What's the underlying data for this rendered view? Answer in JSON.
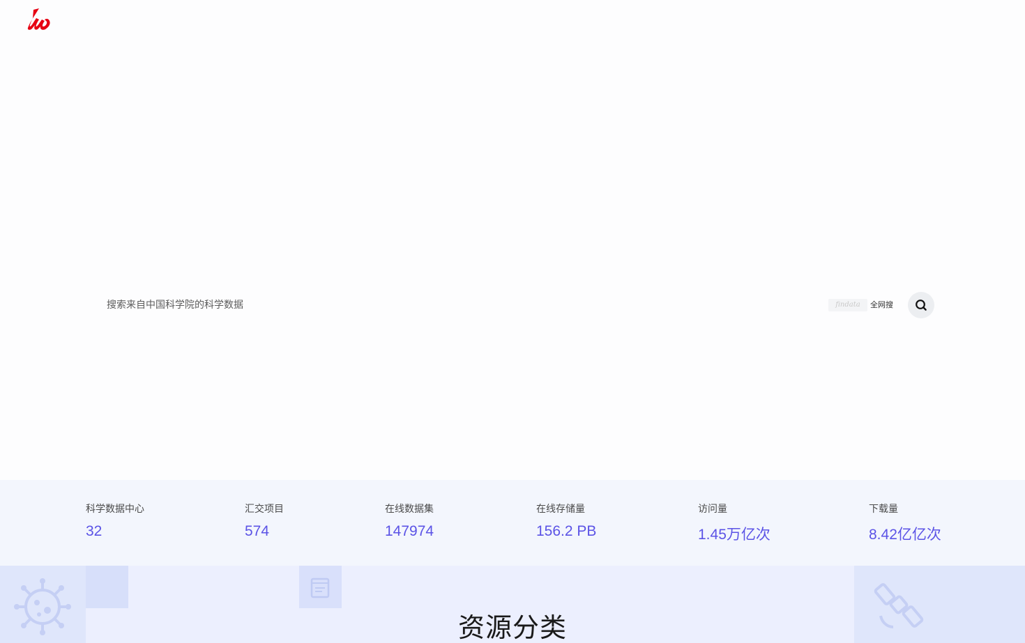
{
  "header": {
    "logo_icon": "cas-logo-icon",
    "brand_color": "#e60012"
  },
  "search": {
    "placeholder": "搜索来自中国科学院的科学数据",
    "findata_label": "findata",
    "web_search_label": "全网搜",
    "button_icon": "search-icon"
  },
  "stats": [
    {
      "label": "科学数据中心",
      "value": "32"
    },
    {
      "label": "汇交项目",
      "value": "574"
    },
    {
      "label": "在线数据集",
      "value": "147974"
    },
    {
      "label": "在线存储量",
      "value": "156.2 PB"
    },
    {
      "label": "访问量",
      "value": "1.45万亿次"
    },
    {
      "label": "下载量",
      "value": "8.42亿亿次"
    }
  ],
  "resources": {
    "title": "资源分类",
    "tile_icons": [
      "virus-icon",
      "document-icon",
      "satellite-icon"
    ]
  },
  "colors": {
    "stat_value": "#5b53e6",
    "stats_background": "#f3f6fd",
    "section_background": "#eceffe"
  }
}
